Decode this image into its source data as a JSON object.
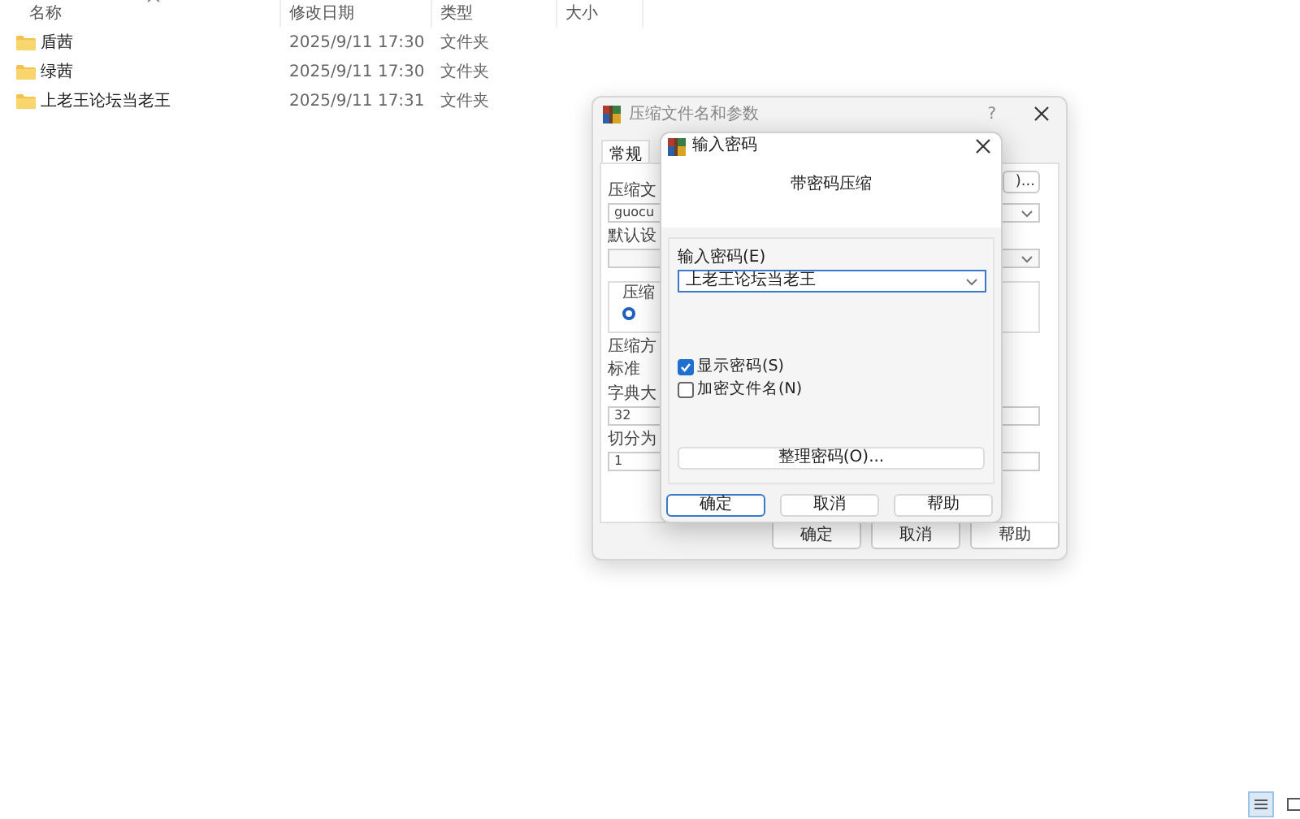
{
  "explorer": {
    "columns": [
      "名称",
      "修改日期",
      "类型",
      "大小"
    ],
    "rows": [
      {
        "name": "盾茜",
        "modified": "2025/9/11 17:30",
        "type": "文件夹"
      },
      {
        "name": "绿茜",
        "modified": "2025/9/11 17:30",
        "type": "文件夹"
      },
      {
        "name": "上老王论坛当老王",
        "modified": "2025/9/11 17:31",
        "type": "文件夹"
      }
    ]
  },
  "archive_dialog": {
    "title": "压缩文件名和参数",
    "help": "?",
    "tabs": [
      {
        "label": "常规",
        "selected": true
      }
    ],
    "browse_button": ")...",
    "name_label": "压缩文",
    "name_value": "guocu",
    "profile_label": "默认设",
    "group_label": "压缩",
    "radio_selected": true,
    "method_label": "压缩方",
    "method_value": "标准",
    "dict_label": "字典大",
    "dict_value": "32",
    "split_label": "切分为",
    "split_value": "1",
    "buttons": [
      "确定",
      "取消",
      "帮助"
    ]
  },
  "password_dialog": {
    "title": "输入密码",
    "heading": "带密码压缩",
    "password_label": "输入密码(E)",
    "password_value": "上老王论坛当老王",
    "checkboxes": [
      {
        "label": "显示密码(S)",
        "checked": true
      },
      {
        "label": "加密文件名(N)",
        "checked": false
      }
    ],
    "manage_button": "整理密码(O)...",
    "buttons": [
      {
        "label": "确定",
        "default": true
      },
      {
        "label": "取消",
        "default": false
      },
      {
        "label": "帮助",
        "default": false
      }
    ]
  },
  "view_buttons": [
    {
      "kind": "details",
      "selected": true
    },
    {
      "kind": "tiles",
      "selected": false
    }
  ]
}
